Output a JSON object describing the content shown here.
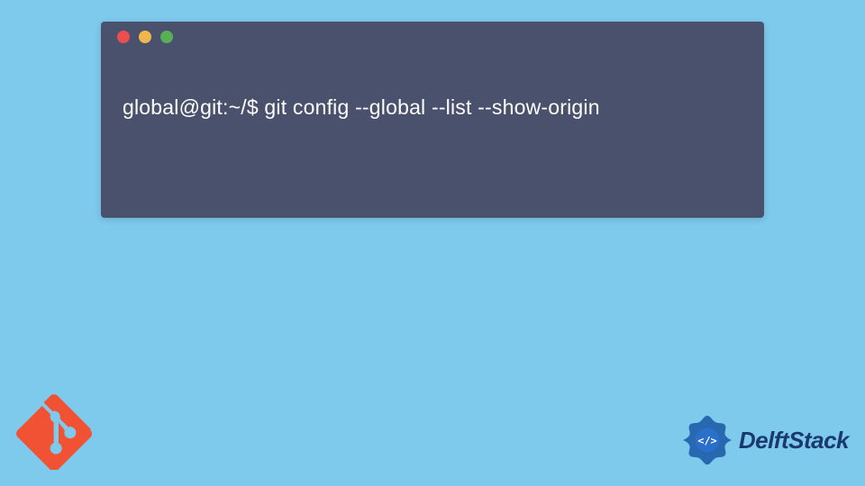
{
  "terminal": {
    "prompt": "global@git:~/$ ",
    "command": "git config --global --list --show-origin",
    "dots": {
      "red": "#ed4e50",
      "yellow": "#f0b84b",
      "green": "#57b056"
    }
  },
  "logos": {
    "git": {
      "fill": "#f15233"
    },
    "delft": {
      "brand_text": "DelftStack",
      "color": "#1a3a6e",
      "accent": "#1857a4"
    }
  },
  "background": "#7ecaed"
}
